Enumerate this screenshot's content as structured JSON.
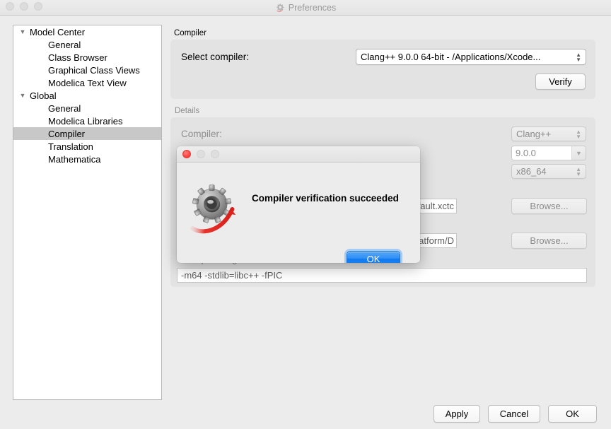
{
  "window": {
    "title": "Preferences",
    "title_icon": "gear-icon"
  },
  "sidebar": {
    "items": [
      {
        "label": "Model Center",
        "level": "parent",
        "selected": false,
        "disclosure": "▼"
      },
      {
        "label": "General",
        "level": "child",
        "selected": false,
        "disclosure": ""
      },
      {
        "label": "Class Browser",
        "level": "child",
        "selected": false,
        "disclosure": ""
      },
      {
        "label": "Graphical Class Views",
        "level": "child",
        "selected": false,
        "disclosure": ""
      },
      {
        "label": "Modelica Text View",
        "level": "child",
        "selected": false,
        "disclosure": ""
      },
      {
        "label": "Global",
        "level": "parent",
        "selected": false,
        "disclosure": "▼"
      },
      {
        "label": "General",
        "level": "child",
        "selected": false,
        "disclosure": ""
      },
      {
        "label": "Modelica Libraries",
        "level": "child",
        "selected": false,
        "disclosure": ""
      },
      {
        "label": "Compiler",
        "level": "child",
        "selected": true,
        "disclosure": ""
      },
      {
        "label": "Translation",
        "level": "child",
        "selected": false,
        "disclosure": ""
      },
      {
        "label": "Mathematica",
        "level": "child",
        "selected": false,
        "disclosure": ""
      }
    ]
  },
  "compiler_group": {
    "title": "Compiler",
    "select_label": "Select compiler:",
    "select_value": "Clang++ 9.0.0 64-bit - /Applications/Xcode...",
    "verify_label": "Verify"
  },
  "details_group": {
    "title": "Details",
    "compiler_label": "Compiler:",
    "compiler_value": "Clang++",
    "version_value": "9.0.0",
    "arch_value": "x86_64",
    "path_value_1": "s/XcodeDefault.xctc",
    "path_value_2": "/MacOSX.platform/D",
    "browse_label_1": "Browse...",
    "browse_label_2": "Browse...",
    "flags_label": "Compiler flags:",
    "flags_value": "-m64 -stdlib=libc++ -fPIC"
  },
  "footer": {
    "apply_label": "Apply",
    "cancel_label": "Cancel",
    "ok_label": "OK"
  },
  "dialog": {
    "message": "Compiler verification succeeded",
    "ok_label": "OK",
    "icon": "gear-with-red-arrow-icon"
  },
  "colors": {
    "window_background": "#ececec",
    "group_background": "#e3e3e3",
    "selection": "#c8c8c8",
    "default_button_blue": "#1f86f5",
    "close_button_red": "#fc4a45",
    "muted_text": "#8b8b8b"
  }
}
